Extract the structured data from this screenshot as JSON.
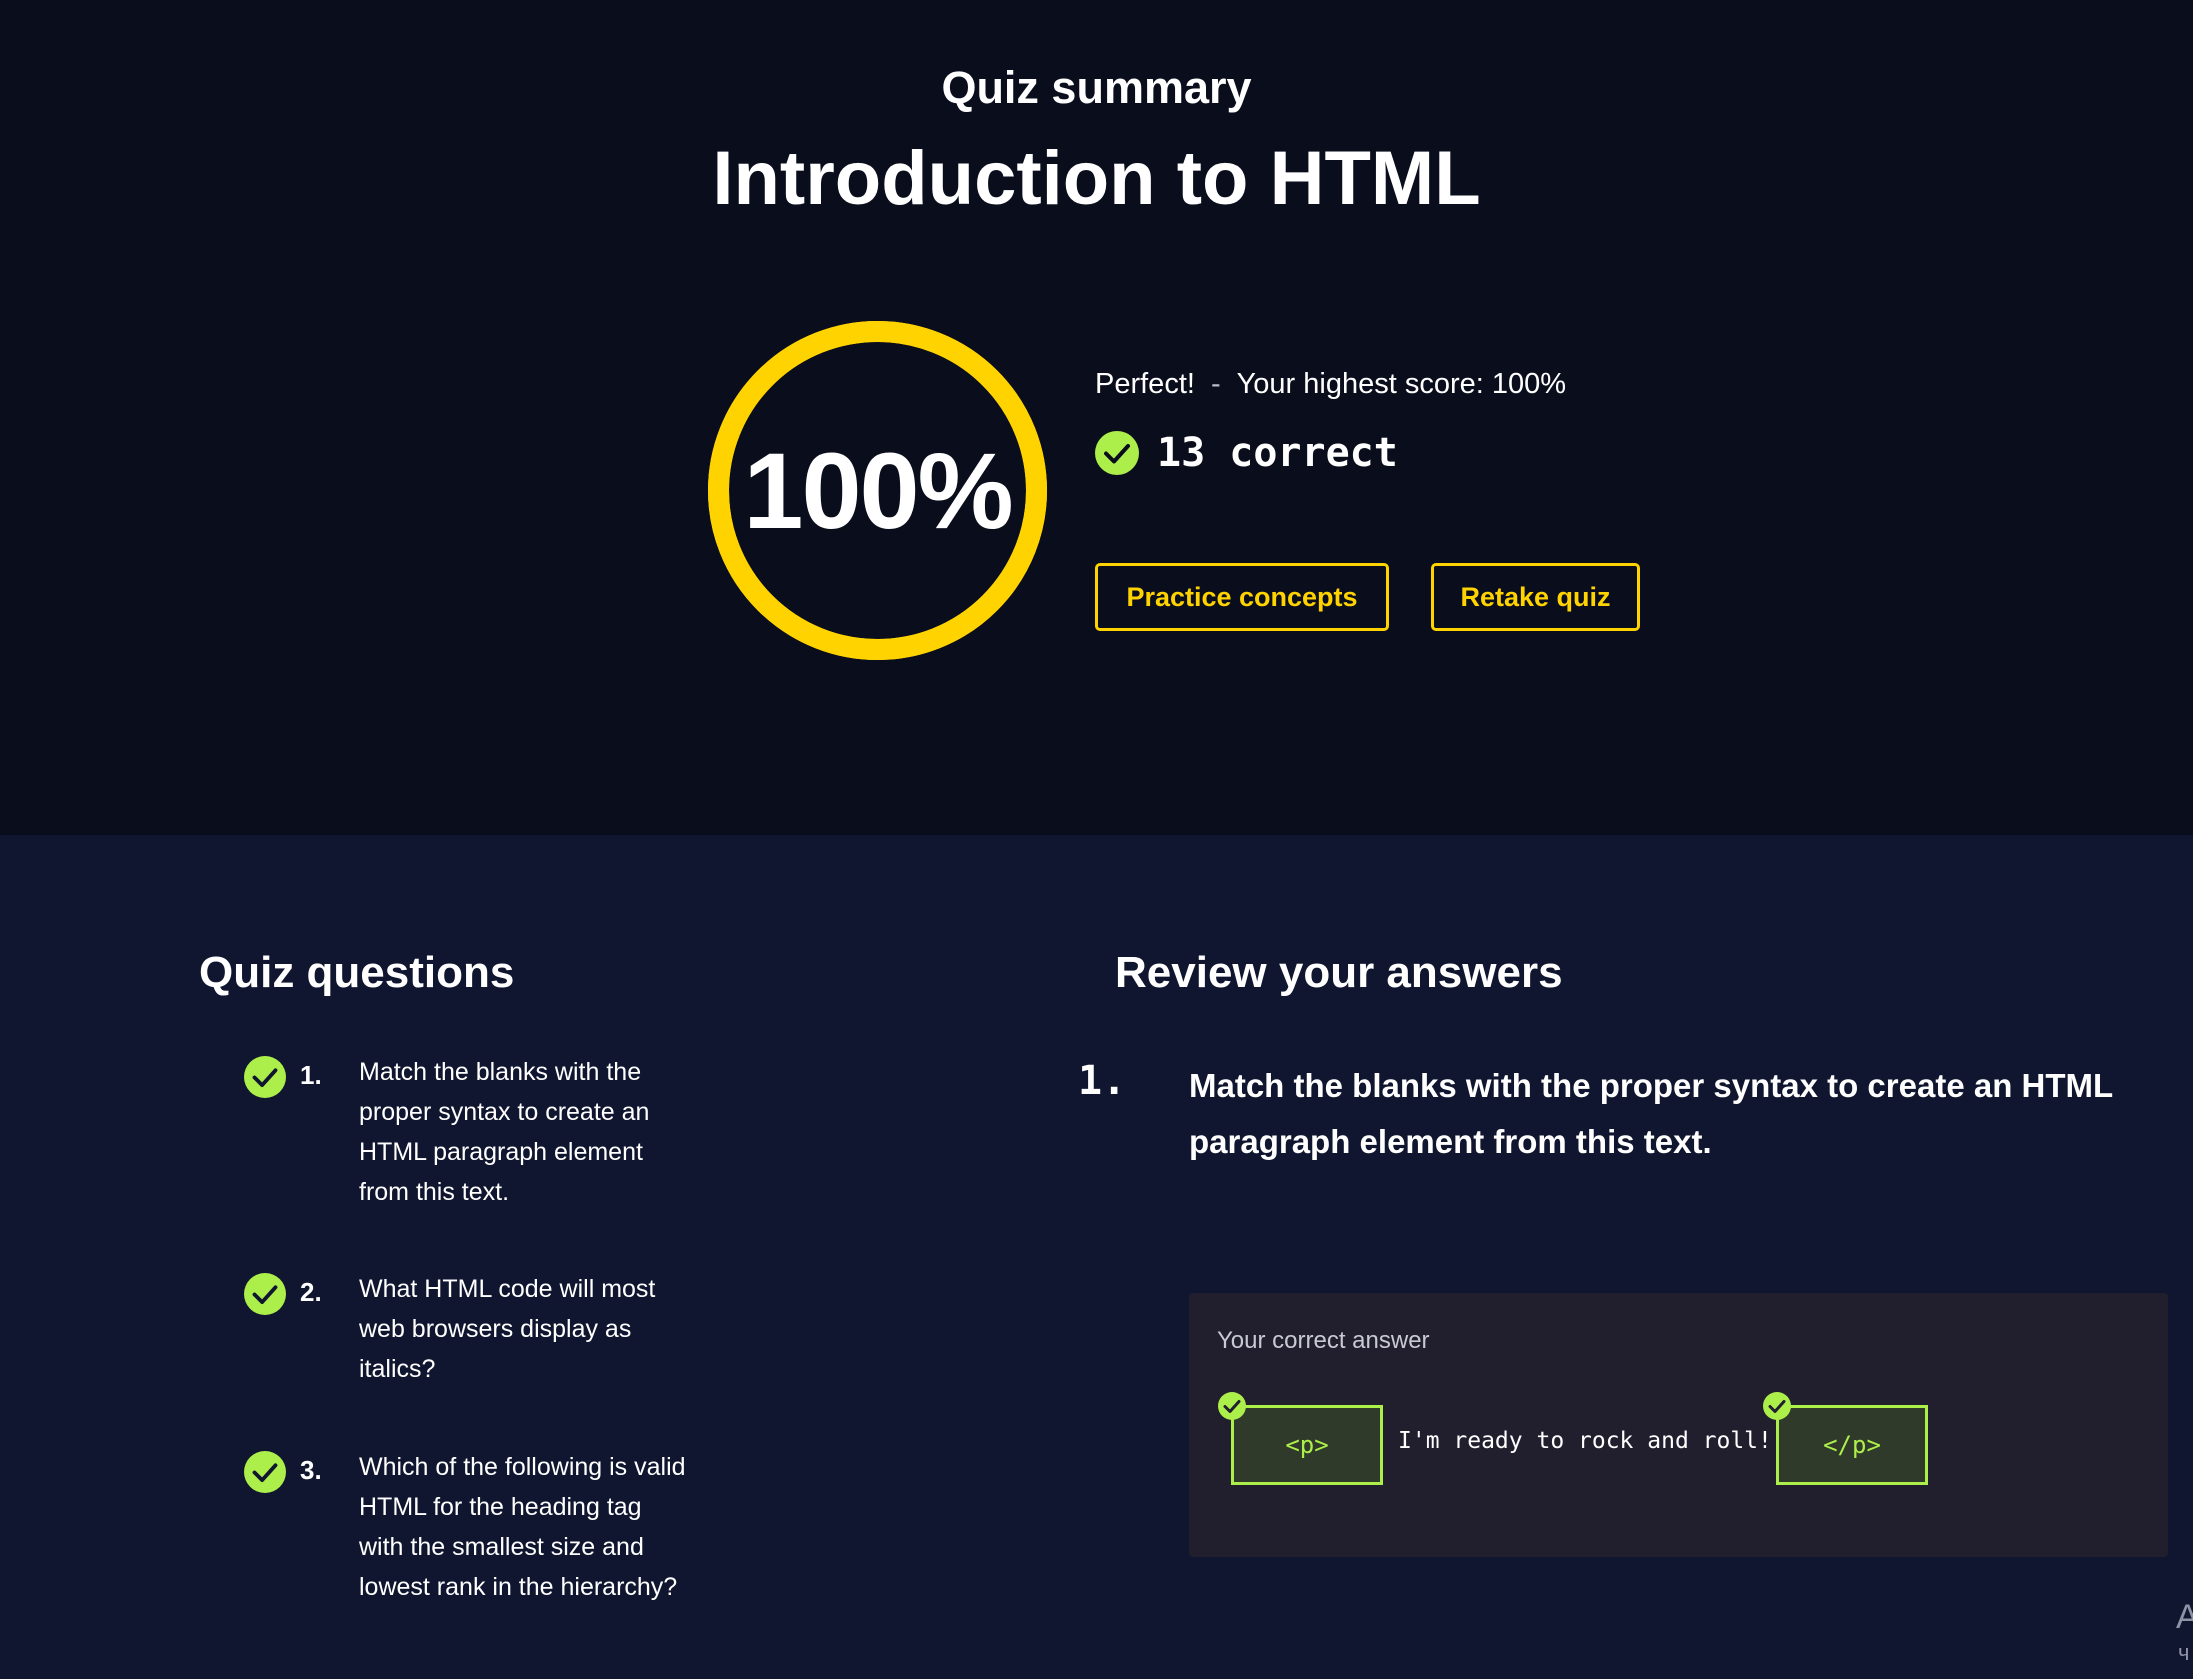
{
  "header": {
    "subtitle": "Quiz summary",
    "title": "Introduction to HTML"
  },
  "score": {
    "percent_text": "100%",
    "fraction": 1.0,
    "status": "Perfect!",
    "separator": "-",
    "highest": "Your highest score: 100%",
    "correct_label": "13 correct"
  },
  "actions": {
    "practice_label": "Practice concepts",
    "retake_label": "Retake quiz"
  },
  "questions": {
    "heading": "Quiz questions",
    "items": [
      {
        "num": "1.",
        "text": "Match the blanks with the proper syntax to create an HTML paragraph element from this text."
      },
      {
        "num": "2.",
        "text": "What HTML code will most web browsers display as italics?"
      },
      {
        "num": "3.",
        "text": "Which of the following is valid HTML for the heading tag with the smallest size and lowest rank in the hierarchy?"
      }
    ]
  },
  "review": {
    "heading": "Review your answers",
    "num": "1.",
    "question": "Match the blanks with the proper syntax to create an HTML paragraph element from this text.",
    "answer_label": "Your correct answer",
    "open_tag": "<p>",
    "answer_text": "I'm ready to rock and roll!",
    "close_tag": "</p>"
  },
  "edge_text": {
    "a": "A",
    "b": "ч"
  },
  "colors": {
    "top_bg": "#0a0d1c",
    "body_bg": "#10162f",
    "accent_yellow": "#ffd300",
    "correct_green": "#adef4a",
    "panel_bg": "#211f2e"
  }
}
